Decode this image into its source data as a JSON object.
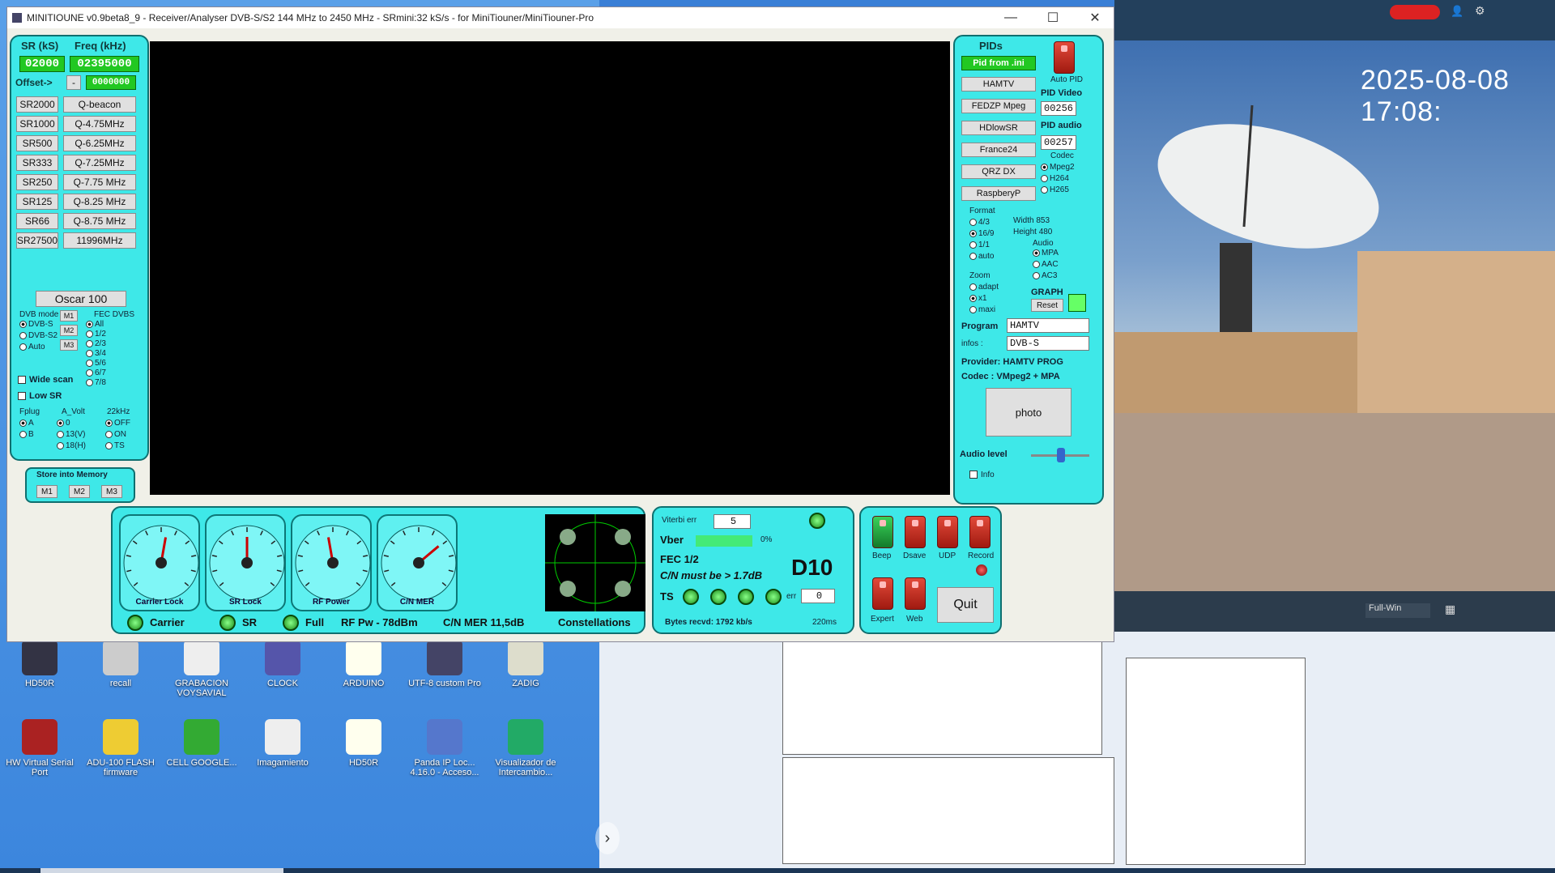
{
  "window": {
    "title": "MINITIOUNE v0.9beta8_9 - Receiver/Analyser DVB-S/S2 144 MHz to 2450 MHz - SRmini:32 kS/s - for MiniTiouner/MiniTiouner-Pro",
    "min": "—",
    "max": "☐",
    "close": "✕"
  },
  "left": {
    "sr_label": "SR (kS)",
    "freq_label": "Freq (kHz)",
    "sr_value": "02000",
    "freq_value": "02395000",
    "offset_label": "Offset->",
    "offset_sign": "-",
    "offset_value": "0000000",
    "sr_buttons": [
      "SR2000",
      "SR1000",
      "SR500",
      "SR333",
      "SR250",
      "SR125",
      "SR66",
      "SR27500"
    ],
    "freq_buttons": [
      "Q-beacon",
      "Q-4.75MHz",
      "Q-6.25MHz",
      "Q-7.25MHz",
      "Q-7.75 MHz",
      "Q-8.25 MHz",
      "Q-8.75 MHz",
      "11996MHz"
    ],
    "oscar": "Oscar 100",
    "dvb_mode": "DVB mode",
    "dvb_opts": [
      "DVB-S",
      "DVB-S2",
      "Auto"
    ],
    "m_btns": [
      "M1",
      "M2",
      "M3"
    ],
    "fec_title": "FEC DVBS",
    "fec_opts": [
      "All",
      "1/2",
      "2/3",
      "3/4",
      "5/6",
      "6/7",
      "7/8"
    ],
    "wide": "Wide scan",
    "lowsr": "Low SR",
    "fplug": "Fplug",
    "fplug_opts": [
      "A",
      "B"
    ],
    "avolt": "A_Volt",
    "avolt_opts": [
      "0",
      "13(V)",
      "18(H)"
    ],
    "khz": "22kHz",
    "khz_opts": [
      "OFF",
      "ON",
      "TS"
    ],
    "store": "Store into Memory",
    "store_btns": [
      "M1",
      "M2",
      "M3"
    ]
  },
  "pids": {
    "title": "PIDs",
    "pid_from_ini": "Pid from .ini",
    "autopid": "Auto PID",
    "presets": [
      "HAMTV",
      "FEDZP Mpeg",
      "HDlowSR",
      "France24",
      "QRZ DX",
      "RaspberyP"
    ],
    "pid_video_label": "PID Video",
    "pid_video": "00256",
    "pid_audio_label": "PID audio",
    "pid_audio": "00257",
    "codec_label": "Codec",
    "codecs": [
      "Mpeg2",
      "H264",
      "H265"
    ],
    "format": "Format",
    "formats": [
      "4/3",
      "16/9",
      "1/1",
      "auto"
    ],
    "width_label": "Width",
    "width": "853",
    "height_label": "Height",
    "height": "480",
    "audio": "Audio",
    "audios": [
      "MPA",
      "AAC",
      "AC3"
    ],
    "zoom": "Zoom",
    "zooms": [
      "adapt",
      "x1",
      "maxi"
    ],
    "graph": "GRAPH",
    "reset": "Reset",
    "program_label": "Program",
    "program": "HAMTV",
    "infos_label": "infos :",
    "infos": "DVB-S",
    "provider": "Provider: HAMTV PROG",
    "codec": "Codec :   VMpeg2 + MPA",
    "photo": "photo",
    "audio_level": "Audio level",
    "info": "Info"
  },
  "gauges": {
    "items": [
      "Carrier Lock",
      "SR Lock",
      "RF Power",
      "C/N MER"
    ],
    "carrier": "Carrier",
    "sr": "SR",
    "full": "Full",
    "rfpw": "RF Pw - 78dBm",
    "cnmer": "C/N MER 11,5dB",
    "constel": "Constellations"
  },
  "viterbi": {
    "label": "Viterbi err",
    "value": "5",
    "vber": "Vber",
    "vber_pct": "0%",
    "fec": "FEC  1/2",
    "cn": "C/N must be > 1.7dB",
    "d": "D10",
    "ts": "TS",
    "err": "err",
    "err_value": "0",
    "bytes": "Bytes recvd:   1792 kb/s",
    "time": "220ms"
  },
  "status": {
    "beep": "Beep",
    "dsave": "Dsave",
    "udp": "UDP",
    "record": "Record",
    "expert": "Expert",
    "web": "Web",
    "quit": "Quit"
  },
  "camera": {
    "timestamp": "2025-08-08 17:08:",
    "view": "Full-Win"
  },
  "desktop": {
    "icons1": [
      "HD50R",
      "recall",
      "GRABACION VOYSAVIAL",
      "CLOCK",
      "ARDUINO",
      "UTF-8 custom Pro",
      "ZADIG"
    ],
    "icons2": [
      "HW Virtual Serial Port",
      "ADU-100 FLASH firmware",
      "CELL GOOGLE...",
      "Imagamiento",
      "HD50R",
      "Panda IP Loc... 4.16.0 - Acceso...",
      "Visualizador de Intercambio..."
    ]
  },
  "colors": {
    "panel": "#3ee8e8",
    "led": "#22c822"
  }
}
